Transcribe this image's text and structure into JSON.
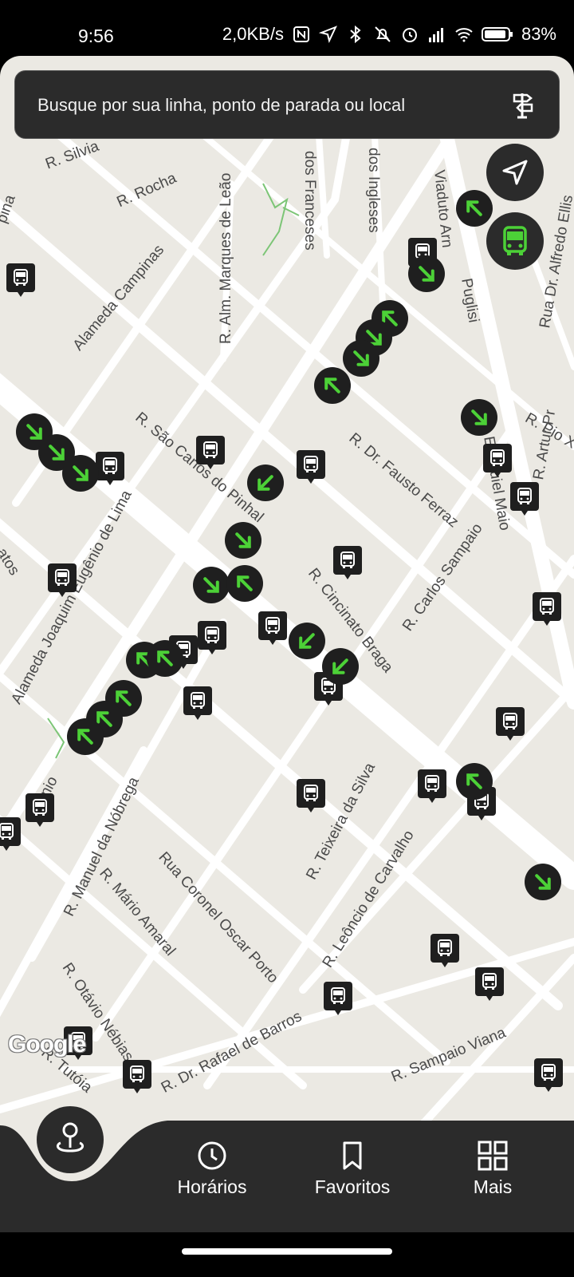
{
  "status_bar": {
    "time": "9:56",
    "network_speed": "2,0KB/s",
    "battery": "83%",
    "icons": [
      "nfc-icon",
      "location-icon",
      "bluetooth-icon",
      "mute-icon",
      "alarm-icon",
      "signal-icon",
      "wifi-icon",
      "battery-icon"
    ]
  },
  "search": {
    "placeholder": "Busque por sua linha, ponto de parada ou local",
    "icon": "signpost-icon"
  },
  "map": {
    "accent": "#4cd137",
    "background": "#ebe9e3",
    "provider_logo": "Google",
    "street_labels": [
      "R. Silvia",
      "R. Rocha",
      "R. Alm. Marques de Leão",
      "dos Franceses",
      "dos Ingleses",
      "Viaduto Arn",
      "Puglisi",
      "Rua Dr. Alfredo Ellis",
      "Alameda Campinas",
      "R. São Carlos do Pinhal",
      "R. Dr. Fausto Ferraz",
      "R. Pio X",
      "R. Cincinato Braga",
      "R. Carlos Sampaio",
      "R. Artur Pr",
      "Alameda Joaquim Eugênio de Lima",
      "R. Manuel da Nóbrega",
      "R. Mário Amaral",
      "Rua Coronel Oscar Porto",
      "R. Teixeira da Silva",
      "R. Leôncio de Carvalho",
      "R. Otávio Nébias",
      "R. Dr. Rafael de Barros",
      "R. Sampaio Viana",
      "R. Tutóia",
      "pina",
      "atos",
      "Ezequiel Maio",
      "nio"
    ]
  },
  "nav": {
    "items": [
      {
        "label": "Horários",
        "icon": "clock-icon"
      },
      {
        "label": "Favoritos",
        "icon": "bookmark-icon"
      },
      {
        "label": "Mais",
        "icon": "grid-icon"
      }
    ]
  }
}
